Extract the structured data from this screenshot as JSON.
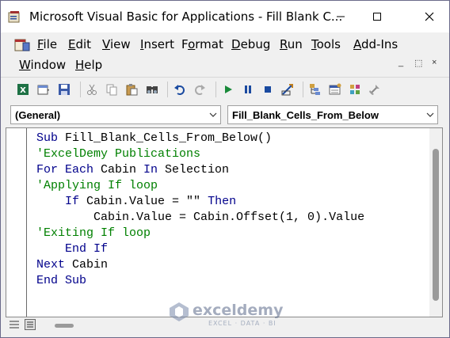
{
  "window": {
    "title": "Microsoft Visual Basic for Applications - Fill Blank C..."
  },
  "menu": {
    "row1": [
      {
        "id": "file",
        "label": "File",
        "mnemonic_index": 0
      },
      {
        "id": "edit",
        "label": "Edit",
        "mnemonic_index": 0
      },
      {
        "id": "view",
        "label": "View",
        "mnemonic_index": 0
      },
      {
        "id": "insert",
        "label": "Insert",
        "mnemonic_index": 0
      },
      {
        "id": "format",
        "label": "Format",
        "mnemonic_index": 1
      },
      {
        "id": "debug",
        "label": "Debug",
        "mnemonic_index": 0
      },
      {
        "id": "run",
        "label": "Run",
        "mnemonic_index": 0
      },
      {
        "id": "tools",
        "label": "Tools",
        "mnemonic_index": 0
      },
      {
        "id": "addins",
        "label": "Add-Ins",
        "mnemonic_index": 0
      }
    ],
    "row2": [
      {
        "id": "window",
        "label": "Window",
        "mnemonic_index": 0
      },
      {
        "id": "help",
        "label": "Help",
        "mnemonic_index": 0
      }
    ],
    "mdi_controls": [
      "_",
      "⬚",
      "×"
    ]
  },
  "toolbar": {
    "icons": [
      "excel-view-icon",
      "insert-module-icon",
      "save-icon",
      "cut-icon",
      "copy-icon",
      "paste-icon",
      "find-icon",
      "undo-icon",
      "redo-icon",
      "run-icon",
      "break-icon",
      "reset-icon",
      "design-mode-icon",
      "project-explorer-icon",
      "properties-icon",
      "object-browser-icon",
      "toolbox-icon"
    ]
  },
  "combos": {
    "object": "(General)",
    "procedure": "Fill_Blank_Cells_From_Below"
  },
  "code": {
    "lines": [
      {
        "indent": 0,
        "parts": [
          {
            "t": "Sub ",
            "c": "kw"
          },
          {
            "t": "Fill_Blank_Cells_From_Below()",
            "c": "tx"
          }
        ]
      },
      {
        "indent": 0,
        "parts": [
          {
            "t": "'ExcelDemy Publications",
            "c": "cm"
          }
        ]
      },
      {
        "indent": 0,
        "parts": [
          {
            "t": "For Each ",
            "c": "kw"
          },
          {
            "t": "Cabin ",
            "c": "tx"
          },
          {
            "t": "In ",
            "c": "kw"
          },
          {
            "t": "Selection",
            "c": "tx"
          }
        ]
      },
      {
        "indent": 0,
        "parts": [
          {
            "t": "'Applying If loop",
            "c": "cm"
          }
        ]
      },
      {
        "indent": 4,
        "parts": [
          {
            "t": "If ",
            "c": "kw"
          },
          {
            "t": "Cabin.Value = \"\" ",
            "c": "tx"
          },
          {
            "t": "Then",
            "c": "kw"
          }
        ]
      },
      {
        "indent": 8,
        "parts": [
          {
            "t": "Cabin.Value = Cabin.Offset(1, 0).Value",
            "c": "tx"
          }
        ]
      },
      {
        "indent": 0,
        "parts": [
          {
            "t": "'Exiting If loop",
            "c": "cm"
          }
        ]
      },
      {
        "indent": 4,
        "parts": [
          {
            "t": "End If",
            "c": "kw"
          }
        ]
      },
      {
        "indent": 0,
        "parts": [
          {
            "t": "Next ",
            "c": "kw"
          },
          {
            "t": "Cabin",
            "c": "tx"
          }
        ]
      },
      {
        "indent": 0,
        "parts": [
          {
            "t": "End Sub",
            "c": "kw"
          }
        ]
      }
    ]
  },
  "watermark": {
    "name": "exceldemy",
    "tagline": "EXCEL · DATA · BI"
  },
  "colors": {
    "keyword": "#00008b",
    "comment": "#008000",
    "text": "#000000"
  }
}
